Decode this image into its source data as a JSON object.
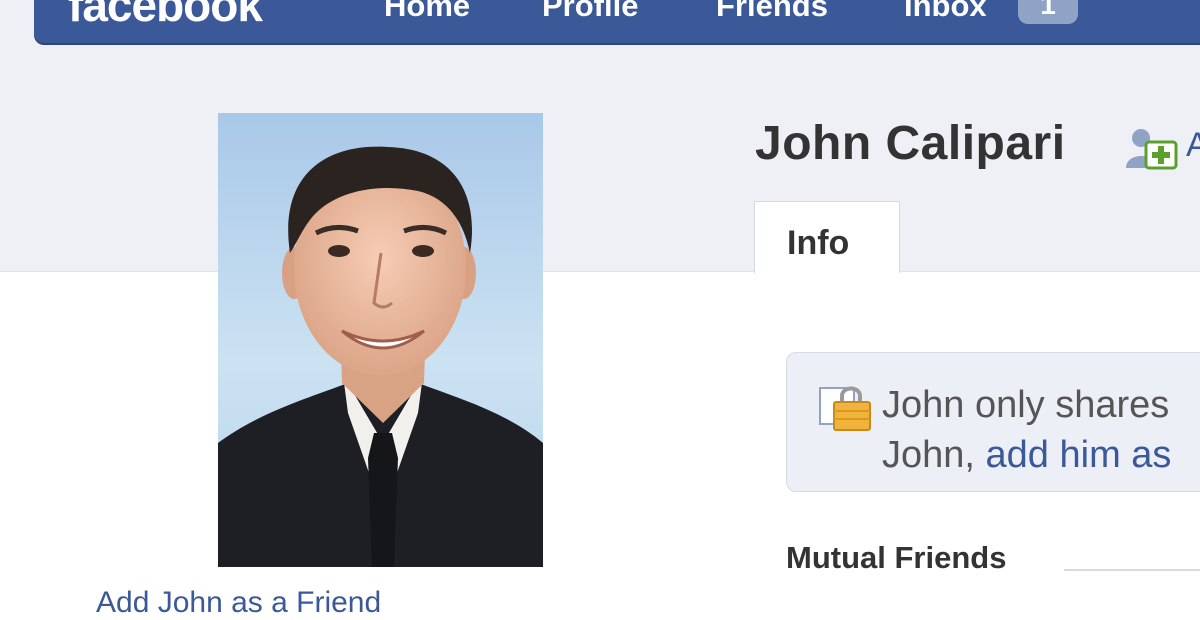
{
  "nav": {
    "logo": "facebook",
    "home": "Home",
    "profile": "Profile",
    "friends": "Friends",
    "inbox": "Inbox",
    "inbox_count": "1"
  },
  "profile": {
    "name": "John Calipari",
    "add_friend_partial": "A",
    "add_friend_link": "Add John as a Friend"
  },
  "tabs": [
    {
      "label": "Info"
    }
  ],
  "notice": {
    "line1": "John only shares",
    "line2_prefix": "John, ",
    "line2_link": "add him as"
  },
  "mutual_friends": {
    "title": "Mutual Friends"
  },
  "colors": {
    "brand": "#3b5998",
    "band": "#eef0f5",
    "text": "#333333"
  },
  "icons": {
    "add_friend": "add-friend-icon",
    "lock": "lock-icon"
  }
}
